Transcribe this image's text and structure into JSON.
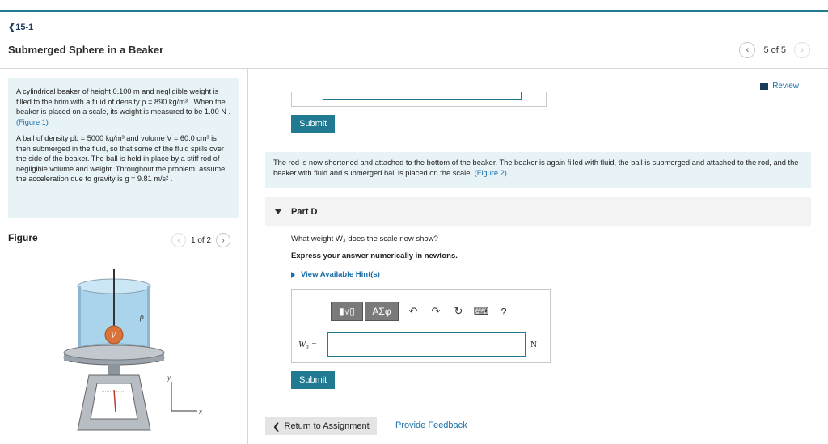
{
  "nav": {
    "back": "15-1"
  },
  "title": "Submerged Sphere in a Beaker",
  "pager": {
    "text": "5 of 5"
  },
  "problem": {
    "p1a": "A cylindrical beaker of height 0.100 m and negligible weight is filled to the brim with a fluid of density",
    "p1b": "ρ = 890 kg/m³ . When the beaker is placed on a scale, its weight is measured to be 1.00 N .",
    "p1link": "(Figure 1)",
    "p2": "A ball of density ρb = 5000 kg/m³ and volume V = 60.0 cm³ is then submerged in the fluid, so that some of the fluid spills over the side of the beaker. The ball is held in place by a stiff rod of negligible volume and weight. Throughout the problem, assume the acceleration due to gravity is g = 9.81 m/s² ."
  },
  "figure": {
    "label": "Figure",
    "pager": "1 of 2",
    "rho_label": "ρ",
    "v_label": "V",
    "y_axis": "y",
    "x_axis": "x"
  },
  "review": "Review",
  "submit_label": "Submit",
  "paragraph": {
    "text": "The rod is now shortened and attached to the bottom of the beaker. The beaker is again filled with fluid, the ball is submerged and attached to the rod, and the beaker with fluid and submerged ball is placed on the scale.",
    "link": "(Figure 2)"
  },
  "part": {
    "label": "Part D"
  },
  "question": "What weight W₃ does the scale now show?",
  "express": "Express your answer numerically in newtons.",
  "hints": "View Available Hint(s)",
  "toolbar": {
    "templates": "▮√▯",
    "symbols": "ΑΣφ",
    "help": "?"
  },
  "answer": {
    "label": "W₃ =",
    "unit": "N",
    "value": ""
  },
  "footer": {
    "return": "Return to Assignment",
    "feedback": "Provide Feedback"
  },
  "colors": {
    "accent": "#1f7a92",
    "link": "#1b6fa8",
    "panel": "#e7f3f6"
  }
}
